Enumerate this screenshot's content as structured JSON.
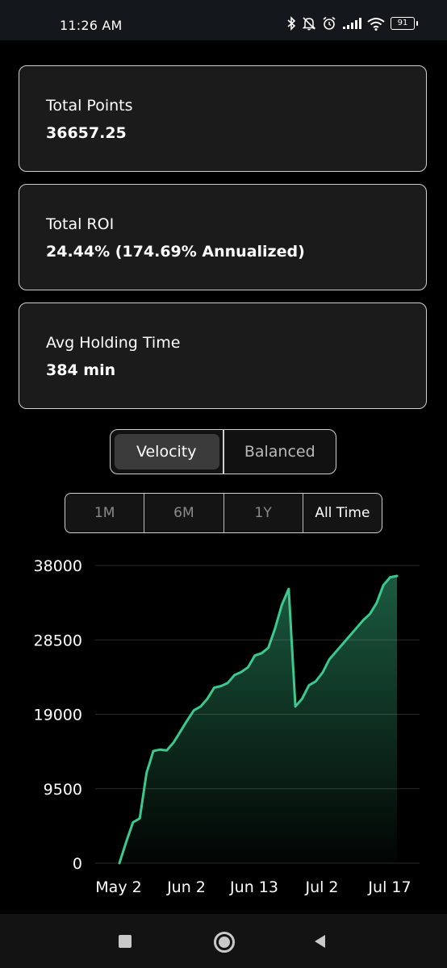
{
  "status_bar": {
    "time": "11:26 AM",
    "battery": "91",
    "icons": [
      "bluetooth-icon",
      "mute-icon",
      "alarm-icon",
      "signal-icon",
      "wifi-icon",
      "battery-icon"
    ]
  },
  "stats": {
    "total_points": {
      "label": "Total Points",
      "value": "36657.25"
    },
    "total_roi": {
      "label": "Total ROI",
      "value": "24.44% (174.69% Annualized)"
    },
    "avg_holding": {
      "label": "Avg Holding Time",
      "value": "384 min"
    }
  },
  "mode_toggle": {
    "options": [
      "Velocity",
      "Balanced"
    ],
    "selected": "Velocity"
  },
  "range_selector": {
    "options": [
      "1M",
      "6M",
      "1Y",
      "All Time"
    ],
    "selected": "All Time"
  },
  "colors": {
    "line": "#3dc98d",
    "card_bg": "#1b1b1b",
    "border": "#cfcfcf"
  },
  "nav_bar": {
    "icons": [
      "recents-icon",
      "home-icon",
      "back-icon"
    ]
  },
  "chart_data": {
    "type": "area",
    "title": "",
    "xlabel": "",
    "ylabel": "",
    "ylim": [
      0,
      38000
    ],
    "yticks": [
      "38000",
      "28500",
      "19000",
      "9500",
      "0"
    ],
    "ytick_values": [
      38000,
      28500,
      19000,
      9500,
      0
    ],
    "xticks": [
      "May 2",
      "Jun 2",
      "Jun 13",
      "Jul 2",
      "Jul 17"
    ],
    "grid": true,
    "series": [
      {
        "values": [
          0,
          2700,
          5200,
          5700,
          11500,
          14300,
          14500,
          14400,
          15400,
          16800,
          18200,
          19500,
          20000,
          21000,
          22400,
          22600,
          23000,
          24000,
          24400,
          25000,
          26500,
          26800,
          27500,
          30000,
          33000,
          35000,
          20000,
          21000,
          22700,
          23200,
          24300,
          26000,
          27000,
          28000,
          29000,
          30000,
          31000,
          31800,
          33200,
          35500,
          36500,
          36657
        ]
      }
    ]
  }
}
